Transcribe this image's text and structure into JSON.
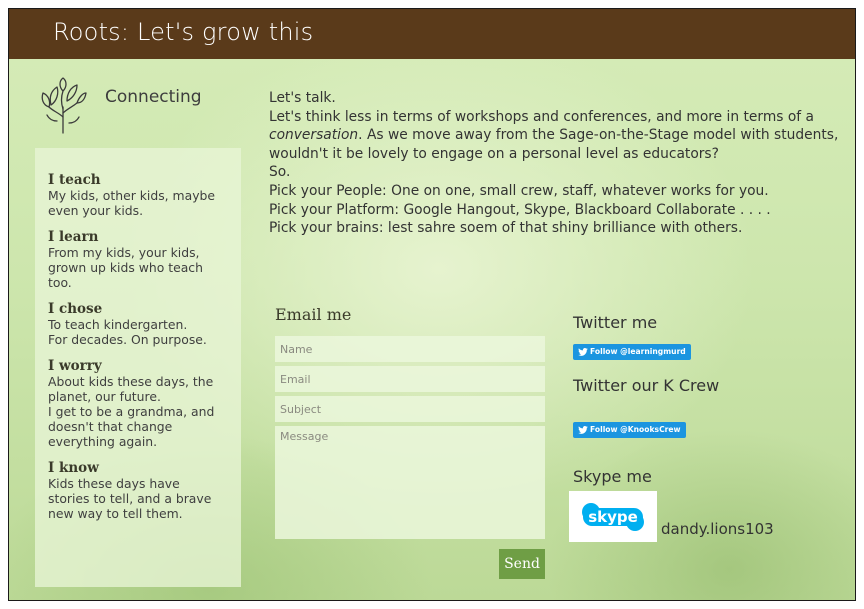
{
  "header": {
    "title": "Roots: Let's grow this"
  },
  "brand": {
    "tagline": "Connecting"
  },
  "profile": [
    {
      "heading": "I teach",
      "text": "My kids, other kids, maybe\neven your kids."
    },
    {
      "heading": "I learn",
      "text": "From my kids, your kids,\ngrown up kids who teach\ntoo."
    },
    {
      "heading": "I chose",
      "text": "To teach kindergarten.\nFor decades. On purpose."
    },
    {
      "heading": "I worry",
      "text": "About kids these days, the\nplanet, our future.\nI get to be a grandma, and\ndoesn't that change\neverything again."
    },
    {
      "heading": "I know",
      "text": "Kids these days have\nstories to tell, and a brave\nnew way to tell them."
    }
  ],
  "intro": {
    "line1": "Let's talk.",
    "line2_pre": "Let's think less in terms of workshops and conferences, and more in terms of a ",
    "line2_em": "conversation",
    "line2_post": ". As we move away from the Sage-on-the-Stage model with students, wouldn't it be lovely to engage on a personal level as educators?",
    "line3": "So.",
    "line4": "Pick your People:  One on one, small crew, staff, whatever works for you.",
    "line5": "Pick your Platform: Google Hangout, Skype, Blackboard Collaborate . . . .",
    "line6": "Pick your brains: lest sahre soem of that shiny brilliance with others."
  },
  "email_form": {
    "heading": "Email me",
    "name_placeholder": "Name",
    "email_placeholder": "Email",
    "subject_placeholder": "Subject",
    "message_placeholder": "Message",
    "send_label": "Send"
  },
  "twitter": {
    "heading": "Twitter me",
    "follow_label": "Follow @learningmurd",
    "crew_heading": "Twitter our K Crew",
    "crew_follow_label": "Follow @KnooksCrew"
  },
  "skype": {
    "heading": "Skype me",
    "logo_text": "skype",
    "username": "dandy.lions103"
  },
  "colors": {
    "header_bg": "#5a3a1a",
    "send_button": "#6f9e45",
    "twitter_blue": "#1b95e0",
    "skype_blue": "#00aff0"
  }
}
